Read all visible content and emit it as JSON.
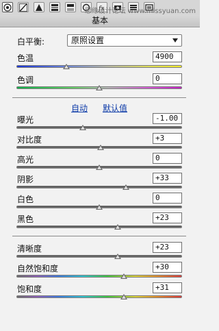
{
  "toolbar": {
    "tools": [
      "aperture-icon",
      "tone-curve-icon",
      "triangle-icon",
      "hsl-grid-icon",
      "split-toning-icon",
      "lens-icon",
      "fx-icon",
      "camera-calibration-icon",
      "presets-icon",
      "snapshots-icon"
    ],
    "watermark": "思缘设计论坛 www.missyuan.com"
  },
  "panel": {
    "title": "基本",
    "white_balance": {
      "label": "白平衡:",
      "value": "原照设置"
    },
    "links": {
      "auto": "自动",
      "default": "默认值"
    },
    "sliders": [
      {
        "id": "temperature",
        "label": "色温",
        "value": "4900",
        "position": 0.3,
        "style": "temp"
      },
      {
        "id": "tint",
        "label": "色调",
        "value": "0",
        "position": 0.5,
        "style": "tint"
      },
      {
        "id": "exposure",
        "label": "曝光",
        "value": "-1.00",
        "position": 0.4,
        "style": "gray"
      },
      {
        "id": "contrast",
        "label": "对比度",
        "value": "+3",
        "position": 0.51,
        "style": "gray"
      },
      {
        "id": "highlights",
        "label": "高光",
        "value": "0",
        "position": 0.5,
        "style": "gray"
      },
      {
        "id": "shadows",
        "label": "阴影",
        "value": "+33",
        "position": 0.66,
        "style": "gray"
      },
      {
        "id": "whites",
        "label": "白色",
        "value": "0",
        "position": 0.5,
        "style": "gray"
      },
      {
        "id": "blacks",
        "label": "黑色",
        "value": "+23",
        "position": 0.61,
        "style": "gray"
      },
      {
        "id": "clarity",
        "label": "清晰度",
        "value": "+23",
        "position": 0.61,
        "style": "gray"
      },
      {
        "id": "vibrance",
        "label": "自然饱和度",
        "value": "+30",
        "position": 0.65,
        "style": "spectrum"
      },
      {
        "id": "saturation",
        "label": "饱和度",
        "value": "+31",
        "position": 0.65,
        "style": "spectrum"
      }
    ]
  }
}
